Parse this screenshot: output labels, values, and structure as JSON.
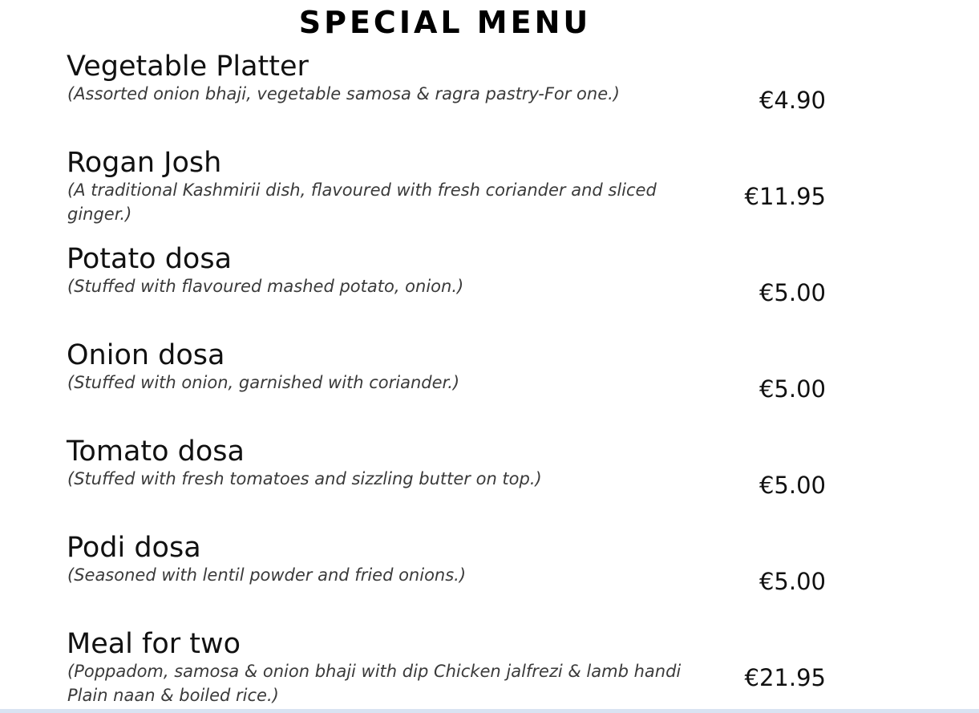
{
  "menu": {
    "title": "SPECIAL MENU",
    "items": [
      {
        "name": "Vegetable Platter",
        "description": "(Assorted onion bhaji, vegetable samosa & ragra pastry-For one.)",
        "price": "€4.90"
      },
      {
        "name": "Rogan Josh",
        "description": "(A traditional Kashmirii dish, flavoured with fresh coriander and sliced ginger.)",
        "price": "€11.95"
      },
      {
        "name": "Potato dosa",
        "description": "(Stuffed with flavoured mashed potato, onion.)",
        "price": "€5.00"
      },
      {
        "name": "Onion dosa",
        "description": "(Stuffed with onion, garnished with coriander.)",
        "price": "€5.00"
      },
      {
        "name": "Tomato dosa",
        "description": "(Stuffed with fresh tomatoes and sizzling butter on top.)",
        "price": "€5.00"
      },
      {
        "name": "Podi dosa",
        "description": "(Seasoned with lentil powder and fried onions.)",
        "price": "€5.00"
      },
      {
        "name": "Meal for two",
        "description": "(Poppadom, samosa & onion bhaji with dip Chicken jalfrezi & lamb handi Plain naan & boiled rice.)",
        "price": "€21.95"
      }
    ]
  }
}
